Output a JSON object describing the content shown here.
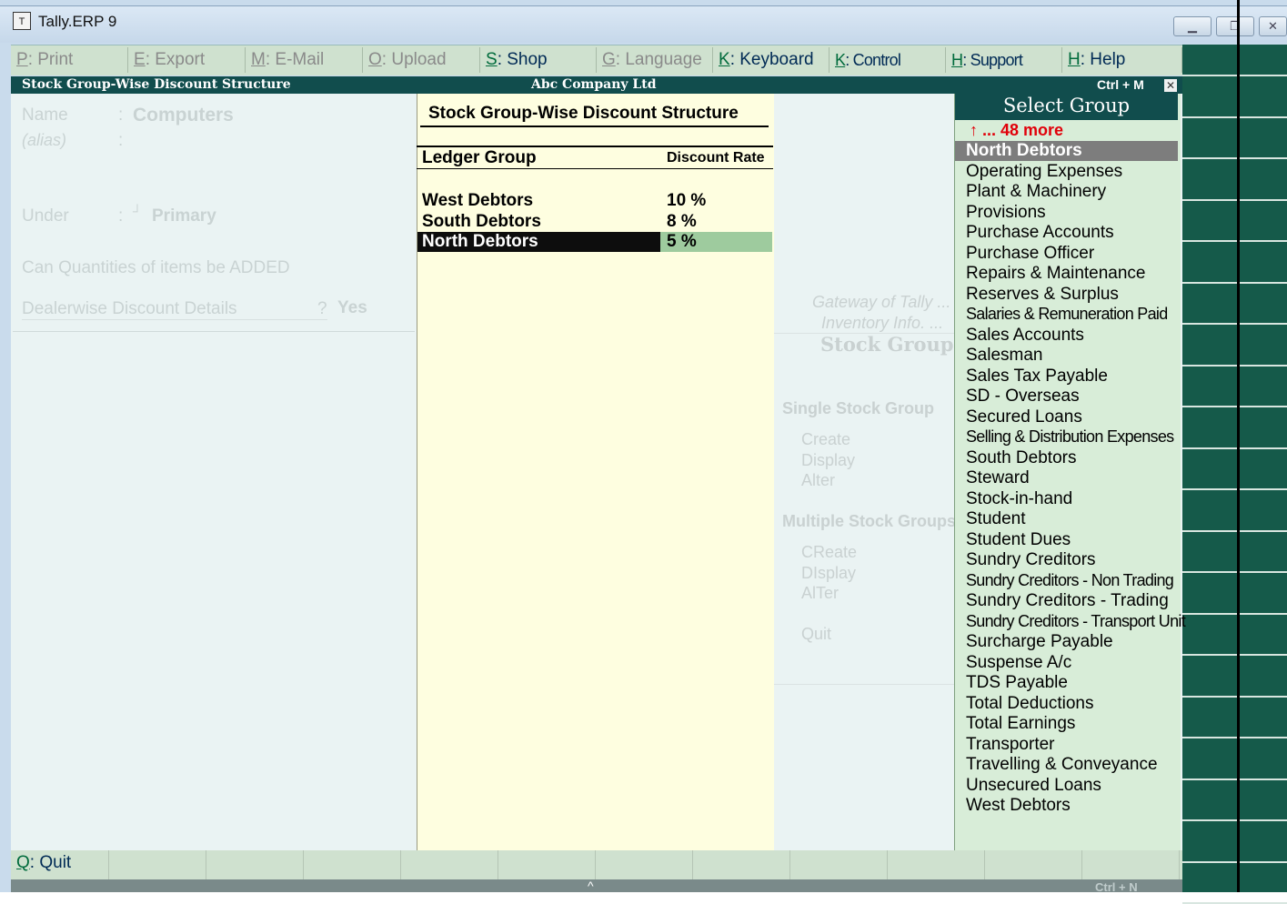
{
  "window": {
    "title": "Tally.ERP 9",
    "icon": "tally-app-icon",
    "controls": [
      "minimize",
      "restore",
      "close"
    ]
  },
  "menu": [
    {
      "key": "P",
      "label": "Print",
      "enabled": false
    },
    {
      "key": "E",
      "label": "Export",
      "enabled": false
    },
    {
      "key": "M",
      "label": "E-Mail",
      "enabled": false
    },
    {
      "key": "O",
      "label": "Upload",
      "enabled": false
    },
    {
      "key": "S",
      "label": "Shop",
      "enabled": true
    },
    {
      "key": "G",
      "label": "Language",
      "enabled": false
    },
    {
      "key": "K",
      "label": "Keyboard",
      "enabled": true
    },
    {
      "key": "K",
      "label": "Control Centre",
      "enabled": true
    },
    {
      "key": "H",
      "label": "Support Centre",
      "enabled": true
    },
    {
      "key": "H",
      "label": "Help",
      "enabled": true
    }
  ],
  "header": {
    "left": "Stock Group-Wise Discount Structure",
    "center": "Abc Company Ltd",
    "right": "Ctrl + M",
    "close": "✕"
  },
  "form": {
    "name_label": "Name",
    "name_value": "Computers",
    "alias_label": "(alias)",
    "colon": ":",
    "under_label": "Under",
    "under_marker": "┘",
    "under_value": "Primary",
    "quantities_label": "Can Quantities of items be ADDED",
    "dealer_label": "Dealerwise Discount Details",
    "dealer_q": "?",
    "dealer_value": "Yes"
  },
  "discount": {
    "title": "Stock Group-Wise Discount Structure",
    "col_group": "Ledger Group",
    "col_rate": "Discount Rate",
    "rows": [
      {
        "group": "West Debtors",
        "rate": "10 %"
      },
      {
        "group": "South Debtors",
        "rate": "8 %"
      },
      {
        "group": "North Debtors",
        "rate": "5 %"
      }
    ]
  },
  "gateway": {
    "line1": "Gateway of Tally ...",
    "line2": "Inventory Info. ...",
    "heading": "Stock Groups",
    "single": "Single Stock Group",
    "single_items": [
      "Create",
      "Display",
      "Alter"
    ],
    "multiple": "Multiple Stock Groups",
    "multiple_items": [
      "CReate",
      "DIsplay",
      "AlTer"
    ],
    "quit": "Quit"
  },
  "select_group": {
    "title": "Select Group",
    "more": "↑ ... 48 more",
    "selected": "North Debtors",
    "items": [
      "North Debtors",
      "Operating Expenses",
      "Plant & Machinery",
      "Provisions",
      "Purchase Accounts",
      "Purchase Officer",
      "Repairs & Maintenance",
      "Reserves & Surplus",
      "Salaries & Remuneration Paid",
      "Sales Accounts",
      "Salesman",
      "Sales Tax Payable",
      "SD - Overseas",
      "Secured Loans",
      "Selling & Distribution Expenses",
      "South Debtors",
      "Steward",
      "Stock-in-hand",
      "Student",
      "Student Dues",
      "Sundry Creditors",
      "Sundry Creditors - Non Trading",
      "Sundry Creditors - Trading",
      "Sundry Creditors - Transport Unit",
      "Surcharge Payable",
      "Suspense A/c",
      "TDS Payable",
      "Total Deductions",
      "Total Earnings",
      "Transporter",
      "Travelling & Conveyance",
      "Unsecured Loans",
      "West Debtors"
    ]
  },
  "bottom": {
    "quit_key": "Q",
    "quit_label": "Quit",
    "ctrl_n": "Ctrl + N",
    "caret": "^"
  }
}
